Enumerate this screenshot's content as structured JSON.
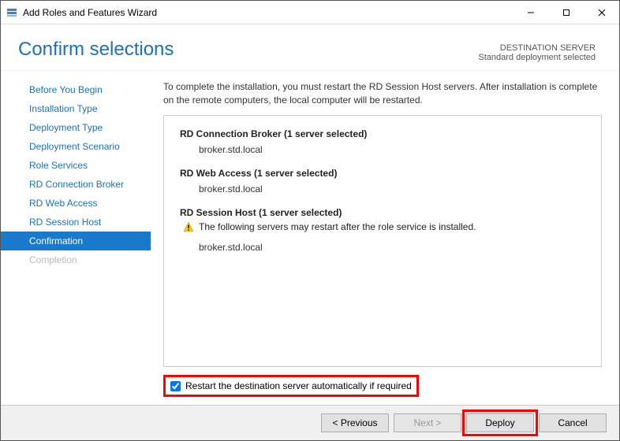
{
  "window": {
    "title": "Add Roles and Features Wizard"
  },
  "header": {
    "heading": "Confirm selections",
    "destLabel": "DESTINATION SERVER",
    "destValue": "Standard deployment selected"
  },
  "sidebar": {
    "steps": [
      {
        "label": "Before You Begin",
        "state": "done"
      },
      {
        "label": "Installation Type",
        "state": "done"
      },
      {
        "label": "Deployment Type",
        "state": "done"
      },
      {
        "label": "Deployment Scenario",
        "state": "done"
      },
      {
        "label": "Role Services",
        "state": "done"
      },
      {
        "label": "RD Connection Broker",
        "state": "done"
      },
      {
        "label": "RD Web Access",
        "state": "done"
      },
      {
        "label": "RD Session Host",
        "state": "done"
      },
      {
        "label": "Confirmation",
        "state": "active"
      },
      {
        "label": "Completion",
        "state": "disabled"
      }
    ]
  },
  "main": {
    "intro": "To complete the installation, you must restart the RD Session Host servers. After installation is complete on the remote computers, the local computer will be restarted.",
    "panel": {
      "role1": "RD Connection Broker  (1 server selected)",
      "server1": "broker.std.local",
      "role2": "RD Web Access  (1 server selected)",
      "server2": "broker.std.local",
      "role3": "RD Session Host  (1 server selected)",
      "warn": "The following servers may restart after the role service is installed.",
      "server3": "broker.std.local"
    },
    "checkbox": {
      "checked": true,
      "label": "Restart the destination server automatically if required"
    }
  },
  "footer": {
    "previous": "< Previous",
    "next": "Next >",
    "deploy": "Deploy",
    "cancel": "Cancel"
  }
}
